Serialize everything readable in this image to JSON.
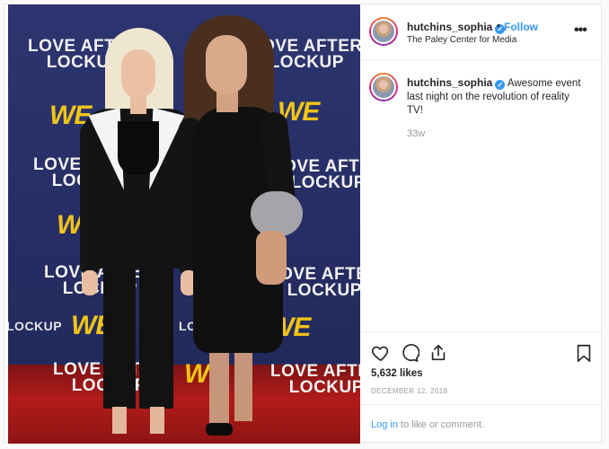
{
  "header": {
    "username": "hutchins_sophia",
    "follow_label": "Follow",
    "separator": "•",
    "location": "The Paley Center for Media",
    "more_label": "•••"
  },
  "caption": {
    "username": "hutchins_sophia",
    "text": "Awesome event last night on the revolution of reality TV!",
    "time_ago": "33w"
  },
  "stats": {
    "likes": "5,632 likes",
    "date": "DECEMBER 12, 2018"
  },
  "comment": {
    "login_link": "Log in",
    "suffix": " to like or comment."
  },
  "photo": {
    "backdrop_text": [
      "LOVE AFTER\nLOCKUP",
      "WE",
      "LOCKUP"
    ],
    "colors": {
      "backdrop": "#2d3570",
      "carpet": "#b21b1b",
      "we_logo": "#f0c417"
    }
  },
  "icons": [
    "verified-badge-icon",
    "heart-icon",
    "comment-icon",
    "share-icon",
    "bookmark-icon",
    "more-options-icon"
  ],
  "colors": {
    "link": "#3897f0",
    "secondary_text": "#999999",
    "border": "#e6e6e6"
  }
}
